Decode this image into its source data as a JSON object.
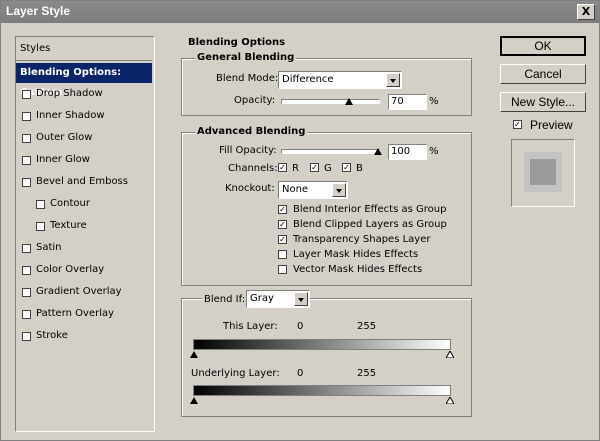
{
  "window": {
    "title": "Layer Style",
    "close_glyph": "X"
  },
  "sidebar": {
    "header": "Styles",
    "selected": "Blending Options: Custom",
    "items": [
      {
        "label": "Drop Shadow",
        "checked": false
      },
      {
        "label": "Inner Shadow",
        "checked": false
      },
      {
        "label": "Outer Glow",
        "checked": false
      },
      {
        "label": "Inner Glow",
        "checked": false
      },
      {
        "label": "Bevel and Emboss",
        "checked": false
      },
      {
        "label": "Contour",
        "checked": false
      },
      {
        "label": "Texture",
        "checked": false
      },
      {
        "label": "Satin",
        "checked": false
      },
      {
        "label": "Color Overlay",
        "checked": false
      },
      {
        "label": "Gradient Overlay",
        "checked": false
      },
      {
        "label": "Pattern Overlay",
        "checked": false
      },
      {
        "label": "Stroke",
        "checked": false
      }
    ]
  },
  "blending": {
    "section_title": "Blending Options",
    "general": {
      "title": "General Blending",
      "blend_mode_label": "Blend Mode:",
      "blend_mode_value": "Difference",
      "opacity_label": "Opacity:",
      "opacity_value": "70",
      "opacity_fraction": 0.7,
      "percent": "%"
    },
    "advanced": {
      "title": "Advanced Blending",
      "fill_opacity_label": "Fill Opacity:",
      "fill_opacity_value": "100",
      "fill_opacity_fraction": 1.0,
      "percent": "%",
      "channels_label": "Channels:",
      "channel_r": "R",
      "channel_g": "G",
      "channel_b": "B",
      "knockout_label": "Knockout:",
      "knockout_value": "None",
      "options": [
        {
          "label": "Blend Interior Effects as Group",
          "checked": true
        },
        {
          "label": "Blend Clipped Layers as Group",
          "checked": true
        },
        {
          "label": "Transparency Shapes Layer",
          "checked": true
        },
        {
          "label": "Layer Mask Hides Effects",
          "checked": false
        },
        {
          "label": "Vector Mask Hides Effects",
          "checked": false
        }
      ]
    },
    "blend_if": {
      "label": "Blend If:",
      "value": "Gray",
      "this_layer_label": "This Layer:",
      "this_layer_min": "0",
      "this_layer_max": "255",
      "underlying_label": "Underlying Layer:",
      "underlying_min": "0",
      "underlying_max": "255"
    }
  },
  "buttons": {
    "ok": "OK",
    "cancel": "Cancel",
    "new_style": "New Style..."
  },
  "preview": {
    "label": "Preview",
    "checked": true
  },
  "colors": {
    "selection": "#0a246a",
    "titlebar": "#808080",
    "face": "#d4d0c8"
  }
}
